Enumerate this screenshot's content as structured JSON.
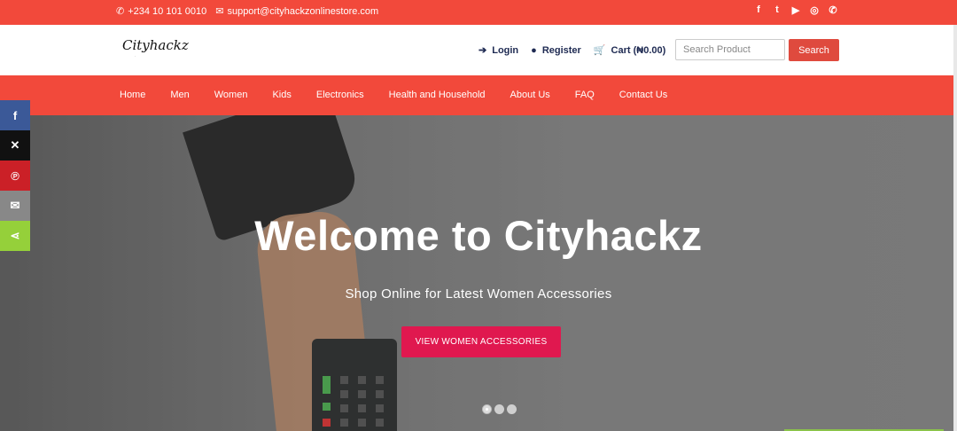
{
  "topbar": {
    "phone": "+234 10 101 0010",
    "email": "support@cityhackzonlinestore.com",
    "social_icons": [
      "facebook-icon",
      "twitter-icon",
      "youtube-icon",
      "instagram-icon",
      "whatsapp-icon"
    ]
  },
  "header": {
    "logo": "Cityhackz",
    "login": "Login",
    "register": "Register",
    "cart": "Cart (₦0.00)",
    "search_placeholder": "Search Product",
    "search_button": "Search"
  },
  "nav": {
    "items": [
      "Home",
      "Men",
      "Women",
      "Kids",
      "Electronics",
      "Health and Household",
      "About Us",
      "FAQ",
      "Contact Us"
    ]
  },
  "hero": {
    "title": "Welcome to Cityhackz",
    "subtitle": "Shop Online for Latest Women Accessories",
    "cta": "VIEW WOMEN ACCESSORIES",
    "slides": 3,
    "active_slide": 1
  },
  "share": {
    "buttons": [
      {
        "name": "facebook-share",
        "glyph": "f",
        "color": "#3b5998"
      },
      {
        "name": "x-share",
        "glyph": "𝕏",
        "color": "#111111"
      },
      {
        "name": "pinterest-share",
        "glyph": "P",
        "color": "#cb2027"
      },
      {
        "name": "email-share",
        "glyph": "✉",
        "color": "#888888"
      },
      {
        "name": "sharethis-share",
        "glyph": "<",
        "color": "#95d03a"
      }
    ]
  },
  "colors": {
    "brand_red": "#f2493b",
    "cta_pink": "#e0184f",
    "nav_text": "#ffffff",
    "header_link": "#1e2a52"
  }
}
